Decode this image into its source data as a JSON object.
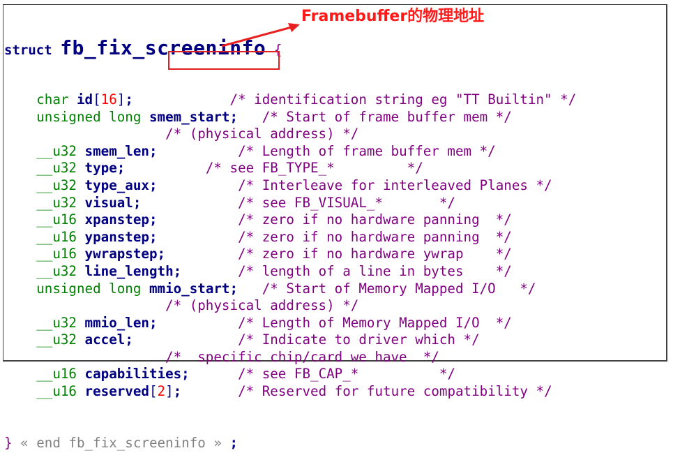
{
  "struct": {
    "keyword": "struct",
    "name": "fb_fix_screeninfo",
    "open_brace": "{",
    "close_brace": "}",
    "end_comment": "« end fb_fix_screeninfo »",
    "end_semicolon": ";"
  },
  "annotation": {
    "text": "Framebuffer的物理地址",
    "color": "#ff1a1a",
    "target_field": "smem_start"
  },
  "colors": {
    "type_keyword": "#008000",
    "identifier": "#000080",
    "number": "#ff0000",
    "comment": "#7f007f",
    "end_note": "#808080",
    "highlight_box": "#e02020"
  },
  "lines": [
    {
      "indent": "    ",
      "type": "char",
      "name": "id",
      "bracket_open": "[",
      "size": "16",
      "bracket_close": "]",
      "semi": ";",
      "pad": "            ",
      "comment": "/* identification string eg \"TT Builtin\" */"
    },
    {
      "indent": "    ",
      "type": "unsigned long",
      "name": "smem_start",
      "semi": ";",
      "pad": "   ",
      "comment": "/* Start of frame buffer mem */"
    },
    {
      "indent": "                    ",
      "comment": "/* (physical address) */"
    },
    {
      "indent": "    ",
      "type": "__u32",
      "name": "smem_len",
      "semi": ";",
      "pad": "          ",
      "comment": "/* Length of frame buffer mem */"
    },
    {
      "indent": "    ",
      "type": "__u32",
      "name": "type",
      "semi": ";",
      "pad": "          ",
      "comment": "/* see FB_TYPE_*         */"
    },
    {
      "indent": "    ",
      "type": "__u32",
      "name": "type_aux",
      "semi": ";",
      "pad": "          ",
      "comment": "/* Interleave for interleaved Planes */"
    },
    {
      "indent": "    ",
      "type": "__u32",
      "name": "visual",
      "semi": ";",
      "pad": "            ",
      "comment": "/* see FB_VISUAL_*       */"
    },
    {
      "indent": "    ",
      "type": "__u16",
      "name": "xpanstep",
      "semi": ";",
      "pad": "          ",
      "comment": "/* zero if no hardware panning  */"
    },
    {
      "indent": "    ",
      "type": "__u16",
      "name": "ypanstep",
      "semi": ";",
      "pad": "          ",
      "comment": "/* zero if no hardware panning  */"
    },
    {
      "indent": "    ",
      "type": "__u16",
      "name": "ywrapstep",
      "semi": ";",
      "pad": "         ",
      "comment": "/* zero if no hardware ywrap    */"
    },
    {
      "indent": "    ",
      "type": "__u32",
      "name": "line_length",
      "semi": ";",
      "pad": "       ",
      "comment": "/* length of a line in bytes    */"
    },
    {
      "indent": "    ",
      "type": "unsigned long",
      "name": "mmio_start",
      "semi": ";",
      "pad": "   ",
      "comment": "/* Start of Memory Mapped I/O   */"
    },
    {
      "indent": "                    ",
      "comment": "/* (physical address) */"
    },
    {
      "indent": "    ",
      "type": "__u32",
      "name": "mmio_len",
      "semi": ";",
      "pad": "          ",
      "comment": "/* Length of Memory Mapped I/O  */"
    },
    {
      "indent": "    ",
      "type": "__u32",
      "name": "accel",
      "semi": ";",
      "pad": "             ",
      "comment": "/* Indicate to driver which */"
    },
    {
      "indent": "                    ",
      "comment": "/*  specific chip/card we have  */"
    },
    {
      "indent": "    ",
      "type": "__u16",
      "name": "capabilities",
      "semi": ";",
      "pad": "      ",
      "comment": "/* see FB_CAP_*          */"
    },
    {
      "indent": "    ",
      "type": "__u16",
      "name": "reserved",
      "bracket_open": "[",
      "size": "2",
      "bracket_close": "]",
      "semi": ";",
      "pad": "       ",
      "comment": "/* Reserved for future compatibility */"
    }
  ]
}
